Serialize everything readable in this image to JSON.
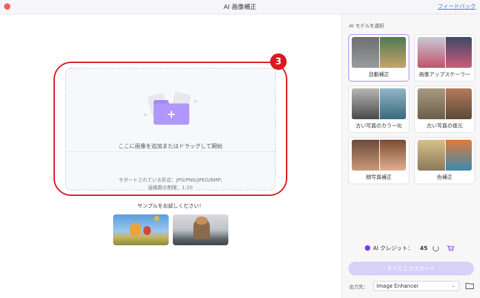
{
  "window": {
    "title": "AI 画像補正",
    "feedback_link": "フィードバック"
  },
  "drop": {
    "step_number": "3",
    "prompt": "ここに画像を追加またはドラッグして開始",
    "formats": "サポートされている形式：JPG/PNG/JPEG/BMP;",
    "limit": "画像数の制限：1-20"
  },
  "samples": {
    "label": "サンプルをお試しください！"
  },
  "sidebar": {
    "model_label": "AI モデルを選択",
    "models": [
      {
        "label": "自動補正",
        "selected": true
      },
      {
        "label": "画像アップスケーラー",
        "selected": false
      },
      {
        "label": "古い写真のカラー化",
        "selected": false
      },
      {
        "label": "古い写真の復元",
        "selected": false
      },
      {
        "label": "顔写真補正",
        "selected": false
      },
      {
        "label": "色補正",
        "selected": false
      }
    ],
    "credit_label": "AI クレジット：",
    "credit_value": "45",
    "export_button": "すべてエクスポート",
    "output_label": "出力先：",
    "output_value": "Image Enhancer"
  },
  "colors": {
    "accent": "#a78bfa",
    "highlight": "#d8191f",
    "link": "#3b74e8"
  }
}
